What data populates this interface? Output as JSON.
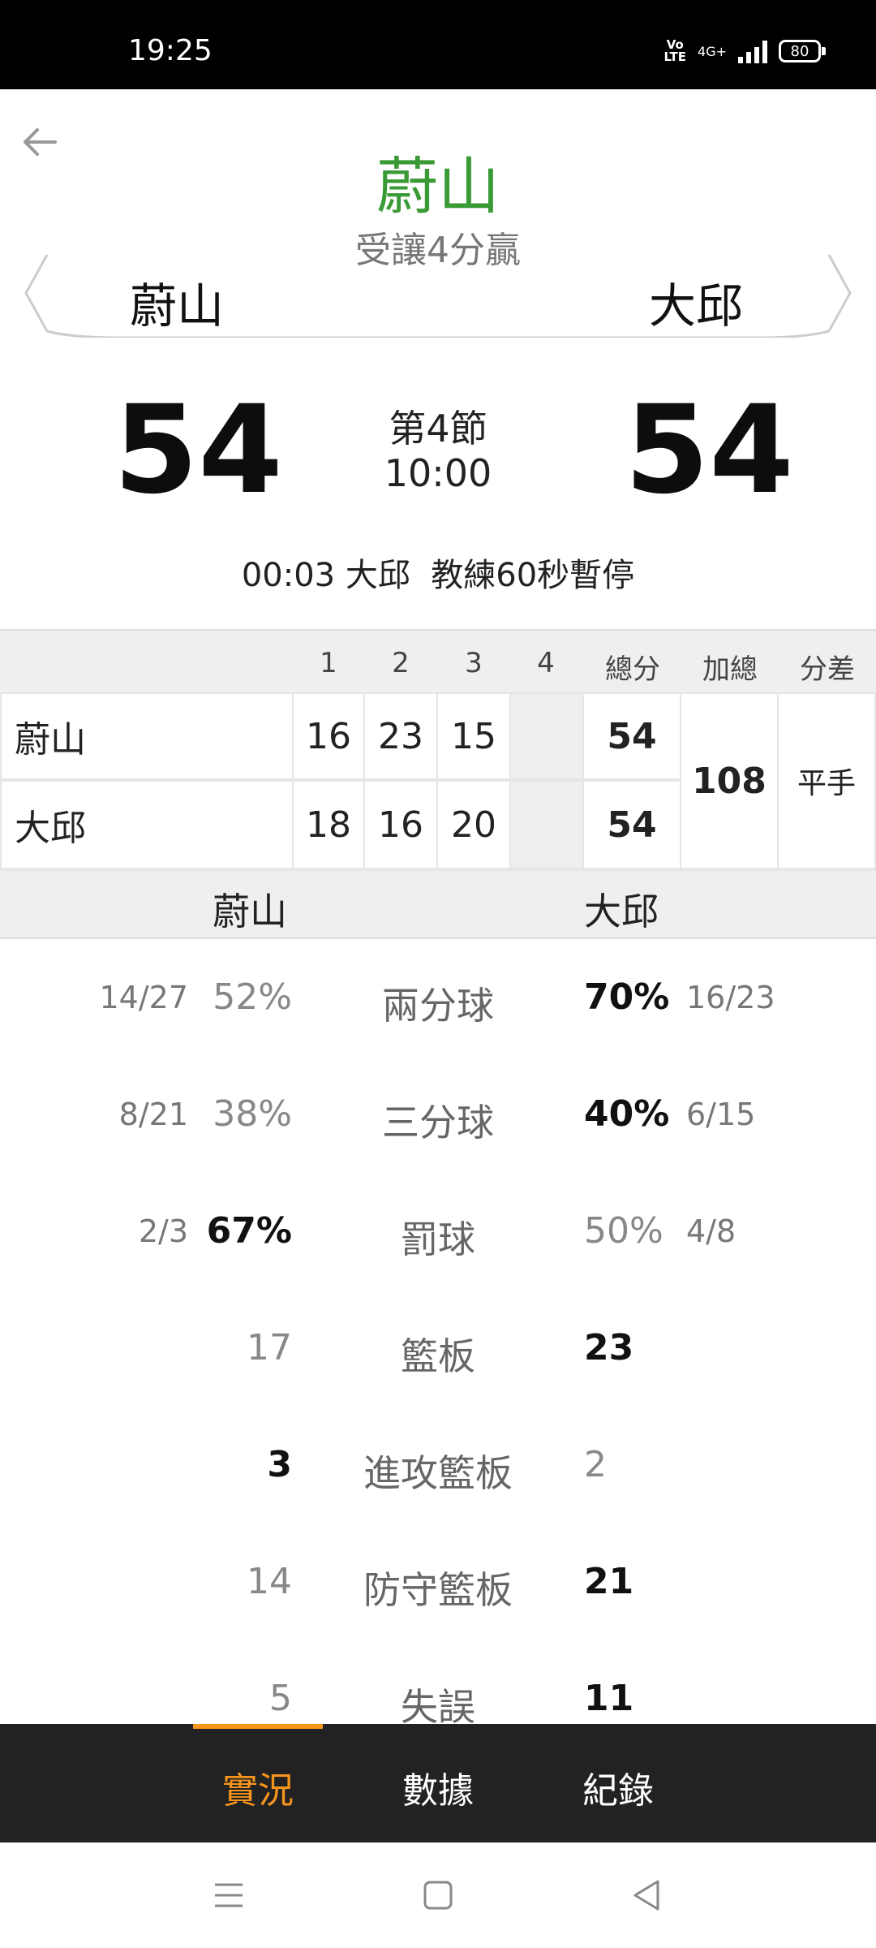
{
  "status_bar": {
    "time": "19:25",
    "network": "4G+",
    "volte": "Vo\nLTE",
    "battery": "80"
  },
  "header": {
    "title": "蔚山",
    "handicap": "受讓4分贏",
    "team_home": "蔚山",
    "team_away": "大邱"
  },
  "scoreboard": {
    "home_score": "54",
    "away_score": "54",
    "period": "第4節",
    "clock": "10:00",
    "last_event": "00:03 大邱  教練60秒暫停"
  },
  "quarters": {
    "headers": [
      "1",
      "2",
      "3",
      "4",
      "總分",
      "加總",
      "分差"
    ],
    "rows": [
      {
        "team": "蔚山",
        "q": [
          "16",
          "23",
          "15",
          ""
        ],
        "total": "54"
      },
      {
        "team": "大邱",
        "q": [
          "18",
          "16",
          "20",
          ""
        ],
        "total": "54"
      }
    ],
    "sum": "108",
    "diff": "平手"
  },
  "stats": {
    "home_team": "蔚山",
    "away_team": "大邱",
    "rows": [
      {
        "label": "兩分球",
        "home_frac": "14/27",
        "home_val": "52%",
        "away_val": "70%",
        "away_frac": "16/23",
        "lead": "away"
      },
      {
        "label": "三分球",
        "home_frac": "8/21",
        "home_val": "38%",
        "away_val": "40%",
        "away_frac": "6/15",
        "lead": "away"
      },
      {
        "label": "罰球",
        "home_frac": "2/3",
        "home_val": "67%",
        "away_val": "50%",
        "away_frac": "4/8",
        "lead": "home"
      },
      {
        "label": "籃板",
        "home_frac": "",
        "home_val": "17",
        "away_val": "23",
        "away_frac": "",
        "lead": "away"
      },
      {
        "label": "進攻籃板",
        "home_frac": "",
        "home_val": "3",
        "away_val": "2",
        "away_frac": "",
        "lead": "home"
      },
      {
        "label": "防守籃板",
        "home_frac": "",
        "home_val": "14",
        "away_val": "21",
        "away_frac": "",
        "lead": "away"
      },
      {
        "label": "失誤",
        "home_frac": "",
        "home_val": "5",
        "away_val": "11",
        "away_frac": "",
        "lead": "away"
      }
    ]
  },
  "tabs": [
    {
      "label": "實況",
      "active": true
    },
    {
      "label": "數據",
      "active": false
    },
    {
      "label": "紀錄",
      "active": false
    }
  ],
  "colors": {
    "title_green": "#3a9a36",
    "tab_active": "#f7941d",
    "tabbar_bg": "#222222"
  },
  "icons": [
    "back-arrow-icon",
    "signal-icon",
    "battery-icon",
    "menu-icon",
    "home-icon",
    "back-triangle-icon"
  ]
}
